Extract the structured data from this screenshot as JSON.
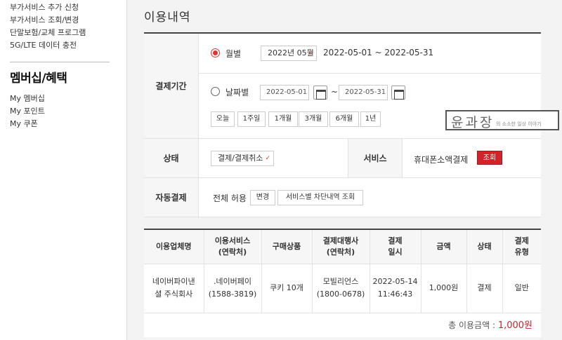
{
  "sidebar": {
    "top_items": [
      "부가서비스 추가 신청",
      "부가서비스 조회/변경",
      "단말보험/교체 프로그램",
      "5G/LTE 데이터 충전"
    ],
    "section_title": "멤버십/혜택",
    "bottom_items": [
      "My 멤버십",
      "My 포인트",
      "My 쿠폰"
    ]
  },
  "page_title": "이용내역",
  "period": {
    "label": "결제기간",
    "monthly_label": "월별",
    "monthly_value": "2022년 05월",
    "range_text": "2022-05-01 ~ 2022-05-31",
    "daily_label": "날짜별",
    "start_date": "2022-05-01",
    "tilde": "~",
    "end_date": "2022-05-31",
    "quick_buttons": [
      "오늘",
      "1주일",
      "1개월",
      "3개월",
      "6개월",
      "1년"
    ]
  },
  "status": {
    "label": "상태",
    "select_value": "결제/결제취소",
    "service_label": "서비스",
    "service_value": "휴대폰소액결제",
    "query_button": "조회"
  },
  "autopay": {
    "label": "자동결제",
    "value": "전체 허용",
    "change_button": "변경",
    "block_button": "서비스별 차단내역 조회"
  },
  "watermark": {
    "main": "윤과장",
    "sub": "의 소소한 일상 이야기"
  },
  "table": {
    "headers": [
      "이용업체명",
      "이용서비스\n(연락처)",
      "구매상품",
      "결제대행사\n(연락처)",
      "결제\n일시",
      "금액",
      "상태",
      "결제\n유형"
    ],
    "rows": [
      [
        "네이버파이낸\n셜 주식회사",
        ".네이버페이\n(1588-3819)",
        "쿠키 10개",
        "모빌리언스\n(1800-0678)",
        "2022-05-14\n11:46:43",
        "1,000원",
        "결제",
        "일반"
      ]
    ],
    "total_label": "총 이용금액 :",
    "total_amount": "1,000원"
  },
  "colors": {
    "accent": "#d4222a",
    "panel_bg": "#f3f3f3"
  }
}
